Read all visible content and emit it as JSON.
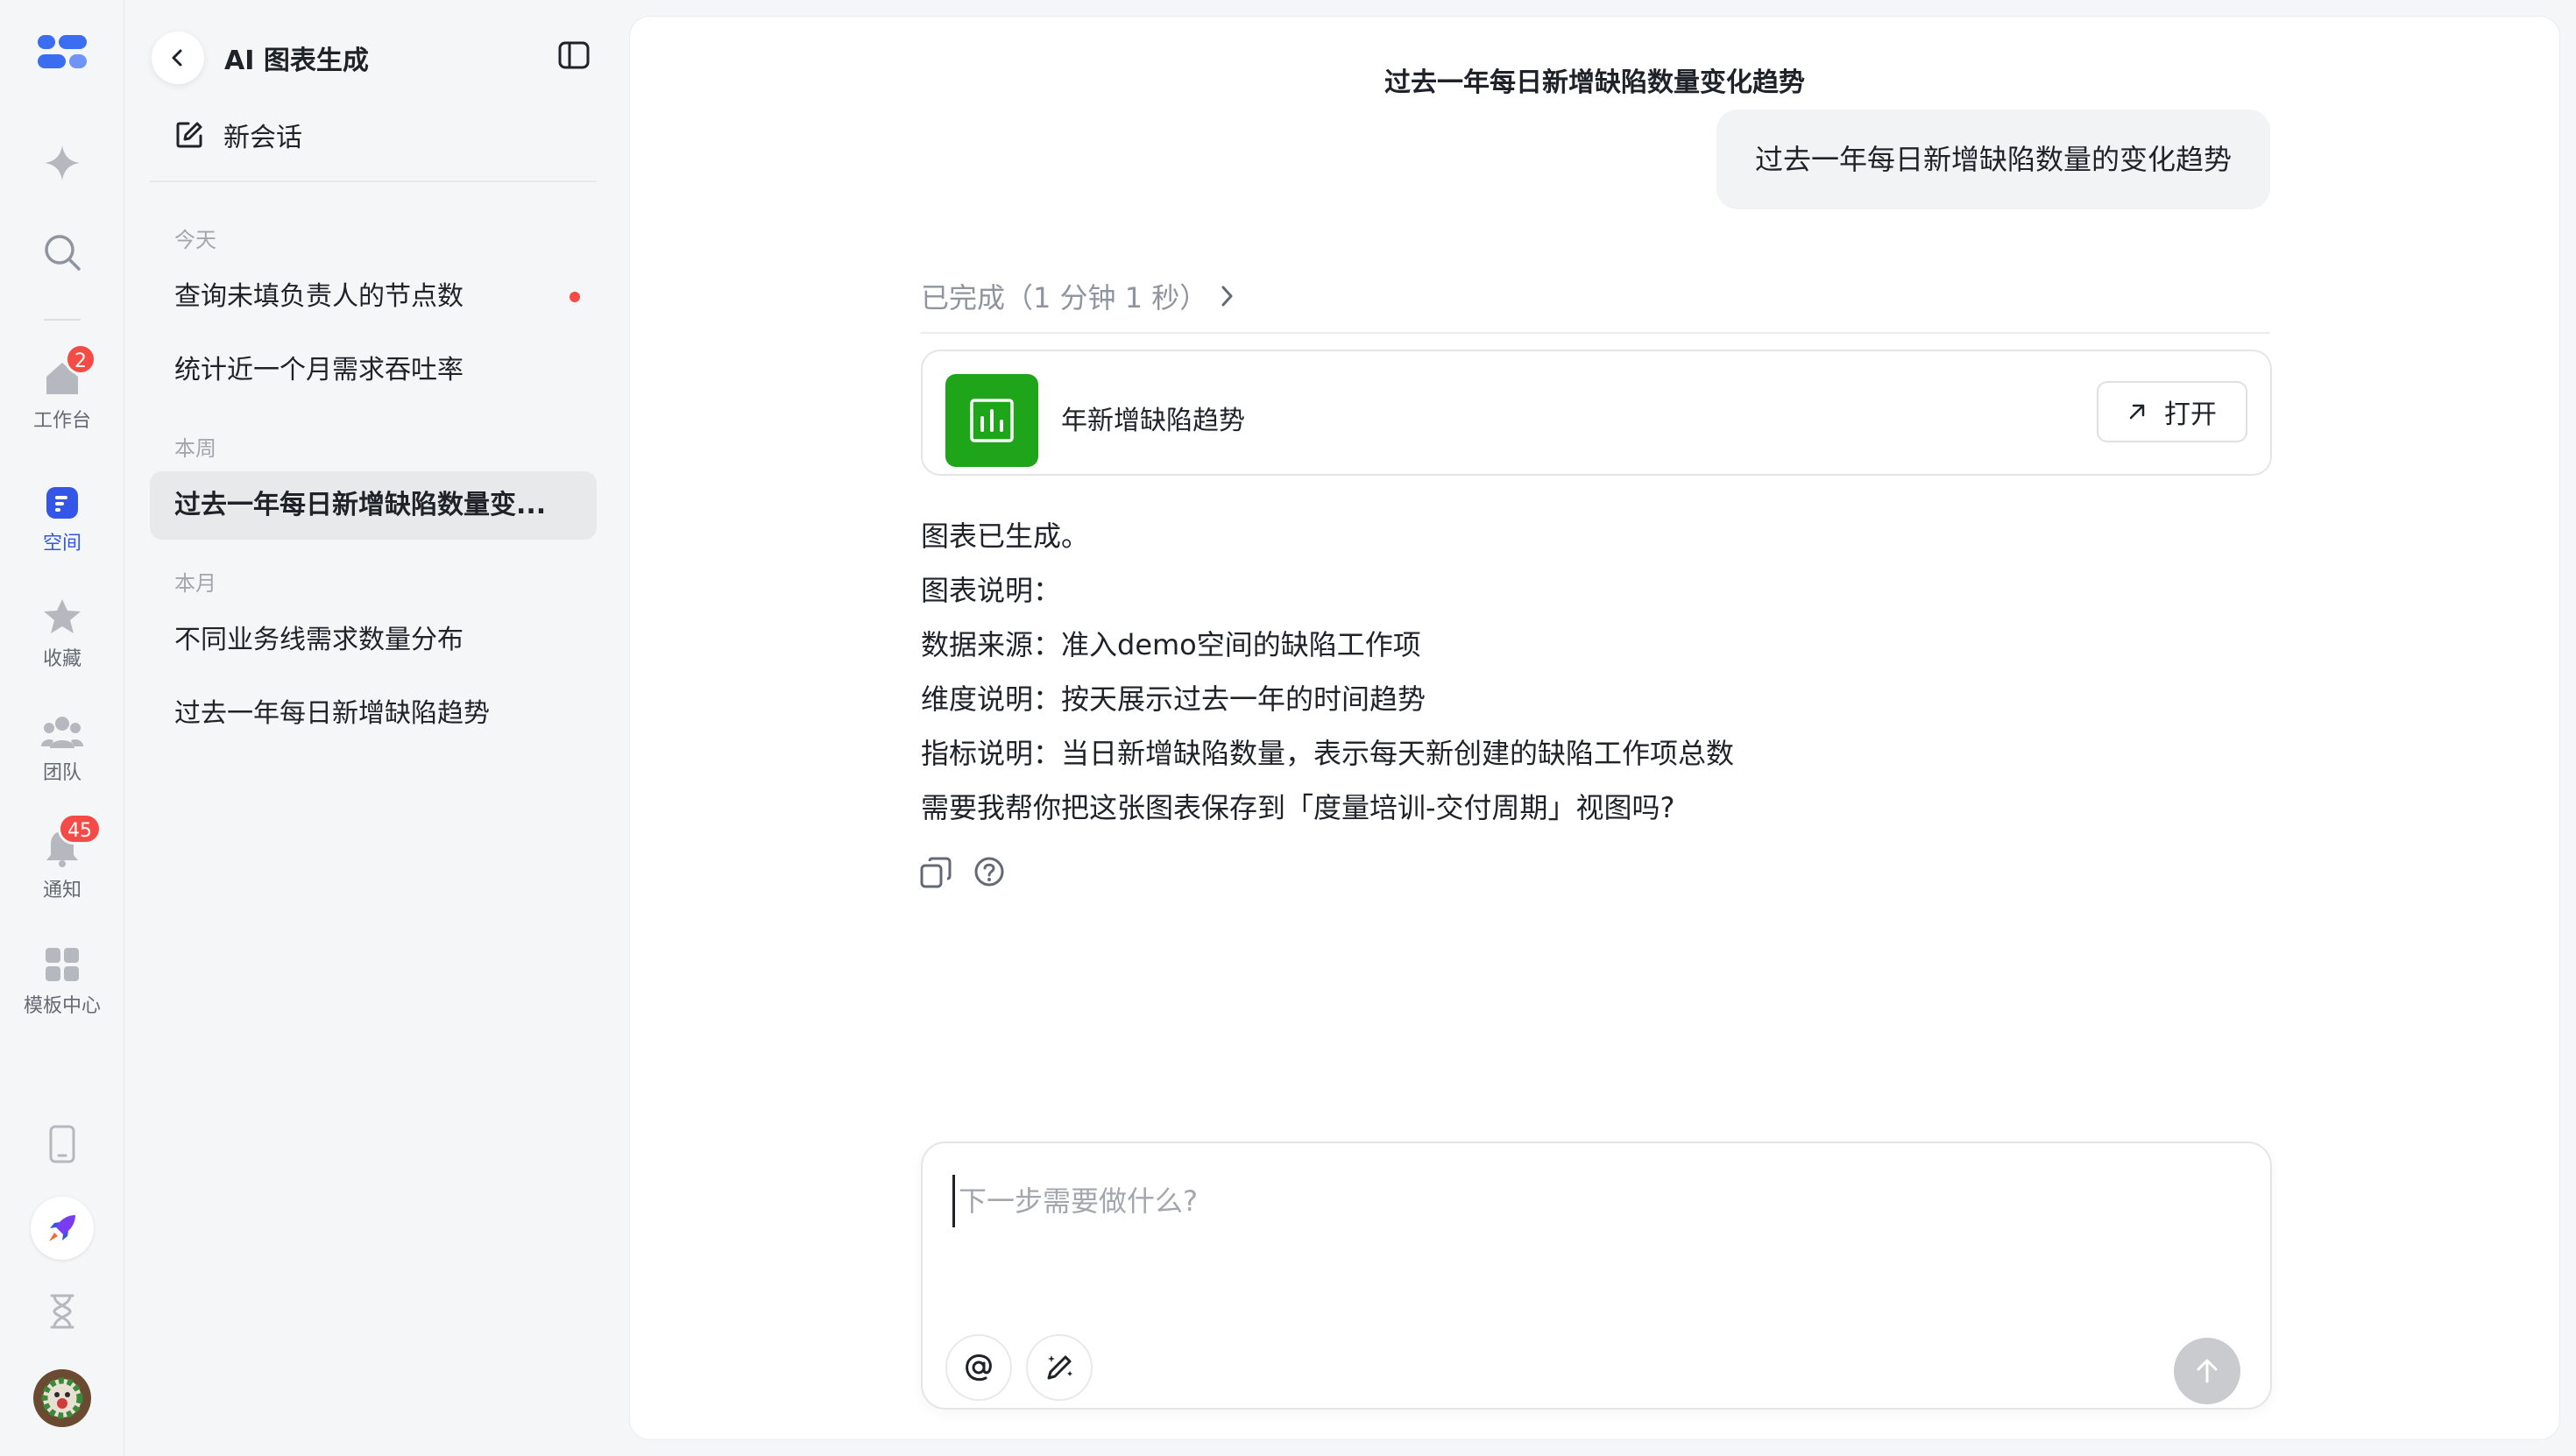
{
  "rail": {
    "items": [
      {
        "label": "工作台",
        "badge": "2"
      },
      {
        "label": "空间"
      },
      {
        "label": "收藏"
      },
      {
        "label": "团队"
      },
      {
        "label": "通知",
        "badge": "45"
      },
      {
        "label": "模板中心"
      }
    ]
  },
  "sidebar": {
    "title": "AI 图表生成",
    "new_chat": "新会话",
    "groups": [
      {
        "label": "今天",
        "items": [
          "查询未填负责人的节点数",
          "统计近一个月需求吞吐率"
        ]
      },
      {
        "label": "本周",
        "items": [
          "过去一年每日新增缺陷数量变..."
        ]
      },
      {
        "label": "本月",
        "items": [
          "不同业务线需求数量分布",
          "过去一年每日新增缺陷趋势"
        ]
      }
    ]
  },
  "main": {
    "title": "过去一年每日新增缺陷数量变化趋势",
    "user_message": "过去一年每日新增缺陷数量的变化趋势",
    "status": "已完成（1 分钟 1 秒）",
    "card": {
      "title": "年新增缺陷趋势",
      "open_label": "打开"
    },
    "answer_lines": [
      "图表已生成。",
      "图表说明：",
      "数据来源：准入demo空间的缺陷工作项",
      "维度说明：按天展示过去一年的时间趋势",
      "指标说明：当日新增缺陷数量，表示每天新创建的缺陷工作项总数",
      "需要我帮你把这张图表保存到「度量培训-交付周期」视图吗?"
    ],
    "composer": {
      "placeholder": "下一步需要做什么?"
    }
  },
  "colors": {
    "accent": "#3355e8",
    "card_icon": "#1ea51a",
    "badge": "#f54a45"
  }
}
